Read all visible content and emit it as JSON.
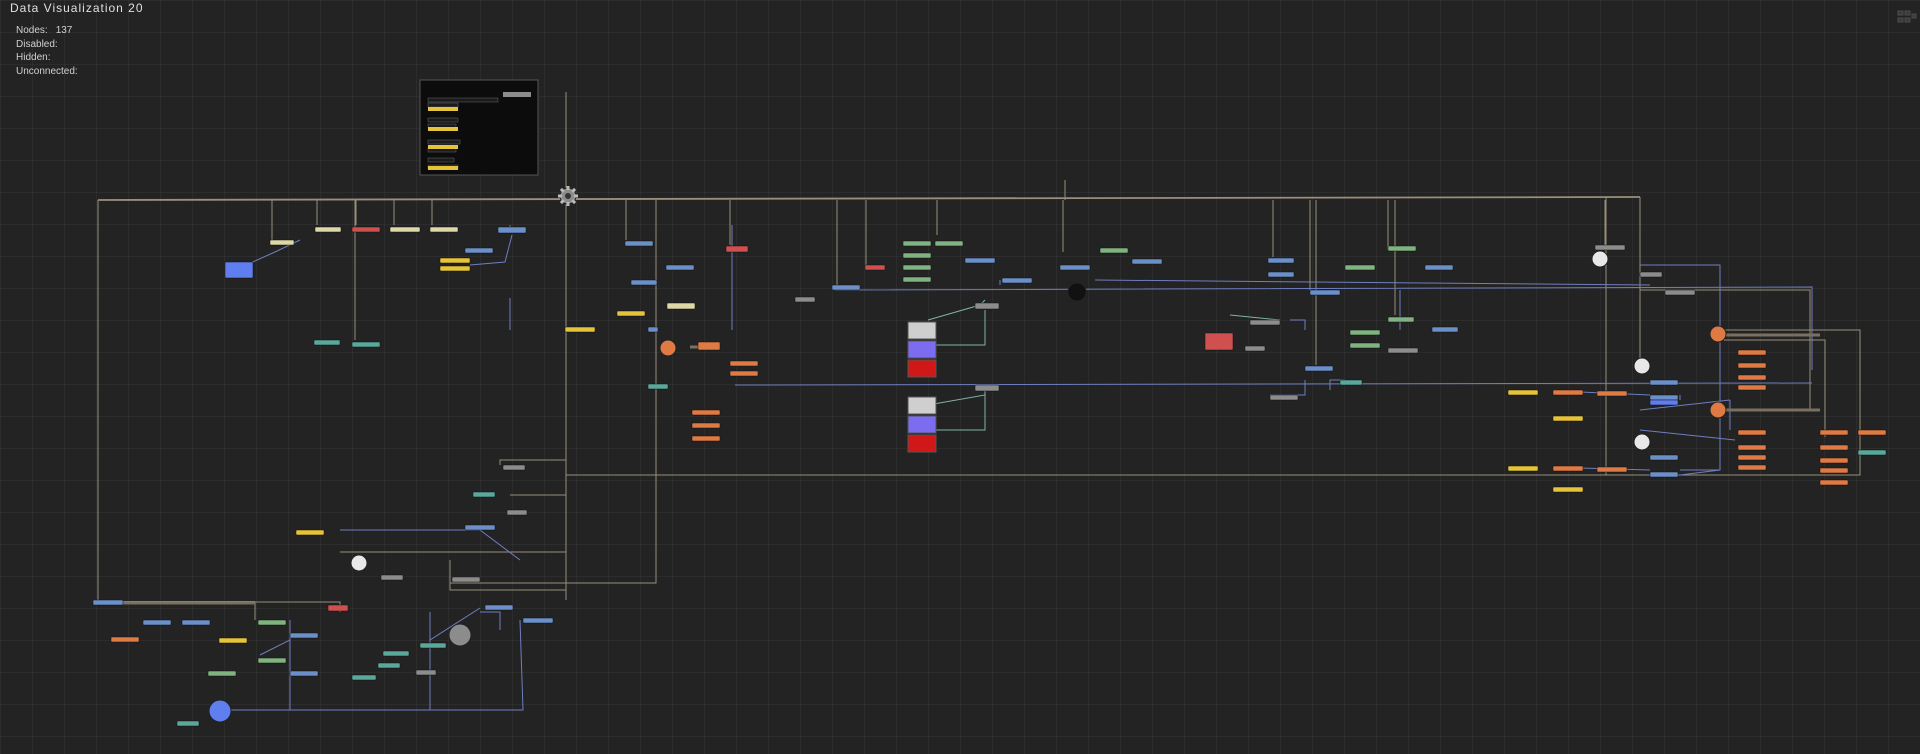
{
  "window": {
    "title": "Data  Visualization  20"
  },
  "stats": [
    {
      "label": "Nodes:",
      "value": "137"
    },
    {
      "label": "Disabled:",
      "value": ""
    },
    {
      "label": "Hidden:",
      "value": ""
    },
    {
      "label": "Unconnected:",
      "value": ""
    }
  ],
  "palette": {
    "edge_beige": "#9a8f7a",
    "edge_blue": "#6f7ec0",
    "edge_teal": "#7fb3a8",
    "node_gray": "#8c8c8c",
    "node_blue": "#6b8fc9",
    "node_yellow": "#e6c43a",
    "node_cream": "#ded8a8",
    "node_green": "#7fb37f",
    "node_orange": "#e07a45",
    "node_red": "#d05050",
    "node_teal": "#5aa89a",
    "node_brightblue": "#5f7ef0"
  },
  "icons": [
    "corner-grid-icon",
    "hub-gear-icon"
  ]
}
